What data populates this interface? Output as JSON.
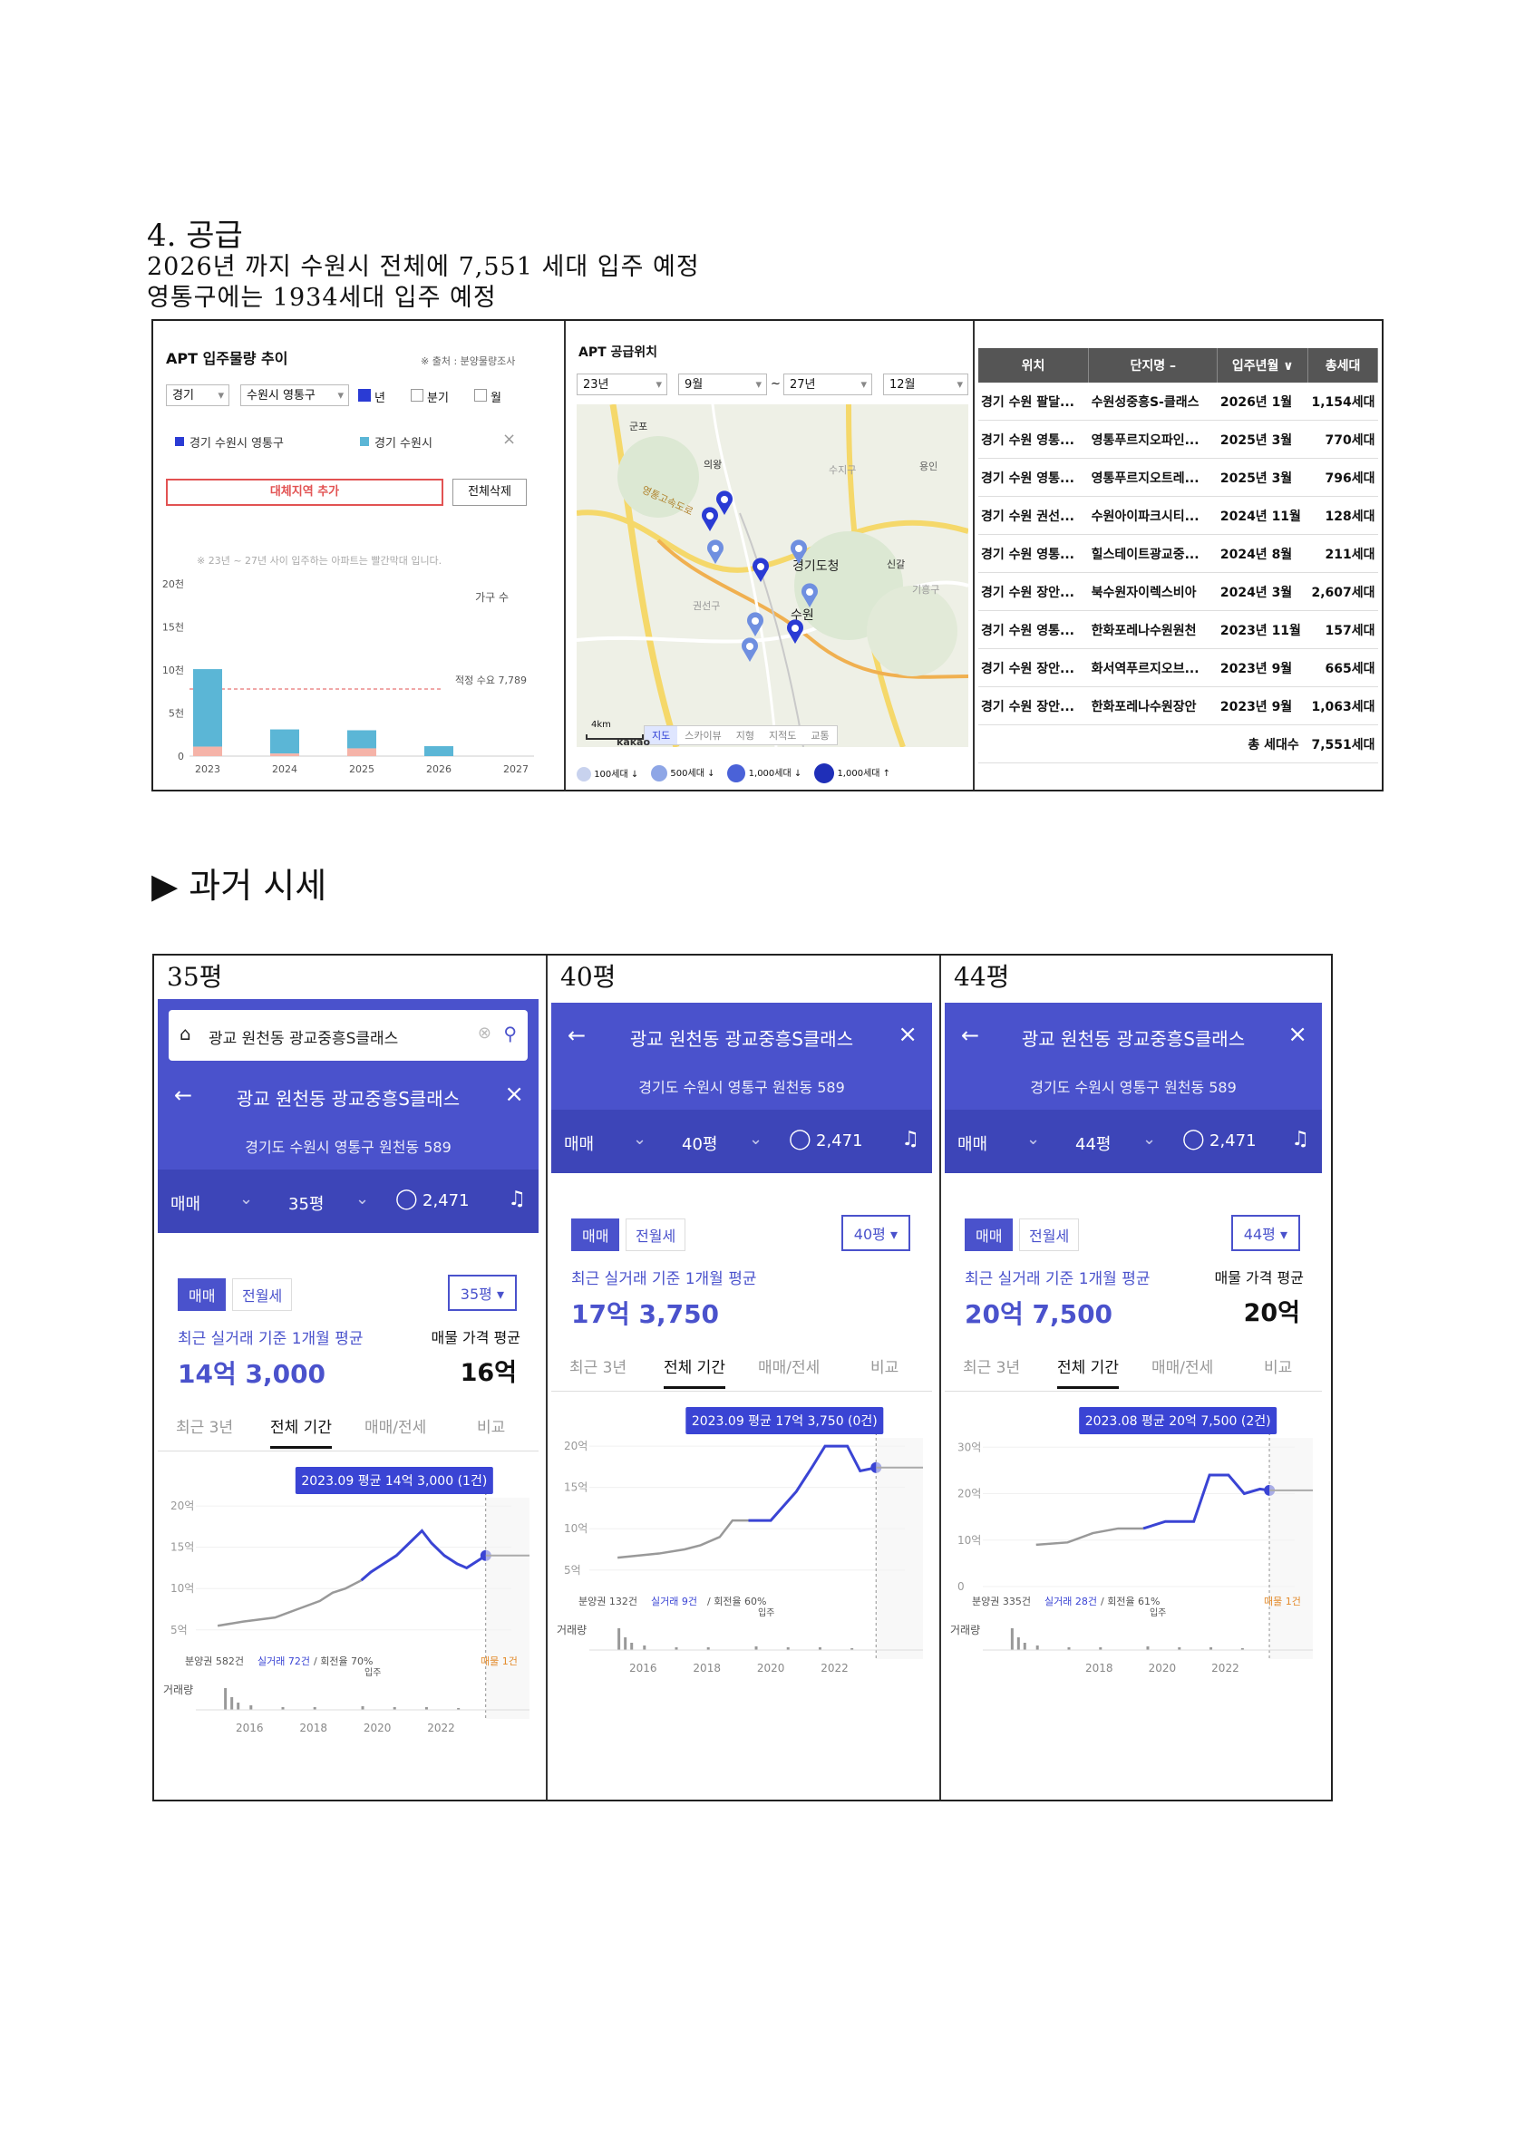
{
  "doc": {
    "heading": "4. 공급",
    "line1": "2026년 까지 수원시 전체에 7,551 세대 입주 예정",
    "line2": "영통구에는 1934세대 입주 예정",
    "past_title": "▶ 과거 시세"
  },
  "supply_panel": {
    "title": "APT 입주물량 추이",
    "source": "※ 출처 : 분양물량조사",
    "region1": "경기",
    "region2": "수원시 영통구",
    "period_options": [
      "년",
      "분기",
      "월"
    ],
    "legend": [
      "경기 수원시 영통구",
      "경기 수원시"
    ],
    "add_button": "대체지역 추가",
    "delete_button": "전체삭제",
    "note": "※ 23년 ~ 27년 사이 입주하는 아파트는 빨간막대 입니다.",
    "unit_label": "가구 수",
    "demand_label": "적정 수요 7,789",
    "chart_data": {
      "type": "bar",
      "categories": [
        "2023",
        "2024",
        "2025",
        "2026",
        "2027"
      ],
      "series": [
        {
          "name": "경기 수원시 영통구",
          "values": [
            1.1,
            0.3,
            0.9,
            0,
            0
          ]
        },
        {
          "name": "경기 수원시",
          "values": [
            10.1,
            3.1,
            3.0,
            1.154,
            0
          ]
        }
      ],
      "yticks": [
        "0",
        "5천",
        "10천",
        "15천",
        "20천"
      ],
      "ylim": [
        0,
        20
      ],
      "demand": 7.789
    }
  },
  "map_panel": {
    "title": "APT 공급위치",
    "from_year": "23년",
    "from_month": "9월",
    "to_year": "27년",
    "to_month": "12월",
    "labels": [
      "군포",
      "의왕",
      "수지구",
      "경기도청",
      "수원",
      "권선구",
      "신갈",
      "기흥구",
      "용인",
      "영통고속도로"
    ],
    "map_tabs": [
      "지도",
      "스카이뷰",
      "지형",
      "지적도",
      "교통"
    ],
    "legend": [
      "100세대 ↓",
      "500세대 ↓",
      "1,000세대 ↓",
      "1,000세대 ↑"
    ],
    "scale": "4km",
    "brand": "kakao",
    "colors": {
      "marker": "#2a3bd4",
      "marker_light": "#6f8fe0"
    }
  },
  "supply_table": {
    "headers": [
      "위치",
      "단지명 –",
      "입주년월 ∨",
      "총세대"
    ],
    "rows": [
      [
        "경기 수원 팔달...",
        "수원성중흥S-클래스",
        "2026년 1월",
        "1,154세대"
      ],
      [
        "경기 수원 영통...",
        "영통푸르지오파인...",
        "2025년 3월",
        "770세대"
      ],
      [
        "경기 수원 영통...",
        "영통푸르지오트레...",
        "2025년 3월",
        "796세대"
      ],
      [
        "경기 수원 권선...",
        "수원아이파크시티...",
        "2024년 11월",
        "128세대"
      ],
      [
        "경기 수원 영통...",
        "힐스테이트광교중...",
        "2024년 8월",
        "211세대"
      ],
      [
        "경기 수원 장안...",
        "북수원자이렉스비아",
        "2024년 3월",
        "2,607세대"
      ],
      [
        "경기 수원 영통...",
        "한화포레나수원원천",
        "2023년 11월",
        "157세대"
      ],
      [
        "경기 수원 장안...",
        "화서역푸르지오브...",
        "2023년 9월",
        "665세대"
      ],
      [
        "경기 수원 장안...",
        "한화포레나수원장안",
        "2023년 9월",
        "1,063세대"
      ]
    ],
    "total_label": "총 세대수",
    "total_value": "7,551세대"
  },
  "phones": [
    {
      "size_label": "35평",
      "search_text": "광교 원천동 광교중흥S클래스",
      "title": "광교 원천동 광교중흥S클래스",
      "address": "경기도 수원시 영통구 원천동 589",
      "trade_type": "매매",
      "size_select": "35평",
      "comments": "2,471",
      "tab_sale": "매매",
      "tab_rent": "전월세",
      "size_pill": "35평",
      "avg_label": "최근 실거래 기준 1개월 평균",
      "avg_price": "14억 3,000",
      "listing_label": "매물 가격 평균",
      "listing_price": "16억",
      "tabs": [
        "최근 3년",
        "전체 기간",
        "매매/전세",
        "비교"
      ],
      "tooltip": "2023.09 평균 14억 3,000 (1건)",
      "yticks": [
        "20억",
        "15억",
        "10억",
        "5억"
      ],
      "footer": "분양권 582건",
      "footer_link": "실거래 72건",
      "footer_rate": "/ 회전율 70%",
      "move_in": "입주",
      "listing_note": "매물 1건",
      "volume_label": "거래량",
      "xticks": [
        "2016",
        "2018",
        "2020",
        "2022"
      ],
      "chart_data": {
        "type": "line",
        "ylim": [
          3,
          21
        ],
        "series": [
          {
            "values": [
              [
                2015.0,
                5.5
              ],
              [
                2015.8,
                6.0
              ],
              [
                2016.8,
                6.5
              ],
              [
                2017.5,
                7.5
              ],
              [
                2018.2,
                8.5
              ],
              [
                2018.6,
                9.5
              ],
              [
                2019.0,
                10.0
              ],
              [
                2019.5,
                11.0
              ],
              [
                2019.8,
                12.0
              ],
              [
                2020.2,
                13.0
              ],
              [
                2020.6,
                14.0
              ],
              [
                2021.0,
                15.5
              ],
              [
                2021.4,
                17.0
              ],
              [
                2021.7,
                15.5
              ],
              [
                2022.1,
                14.0
              ],
              [
                2022.5,
                13.0
              ],
              [
                2022.8,
                12.5
              ],
              [
                2023.2,
                13.5
              ],
              [
                2023.4,
                14.0
              ]
            ]
          }
        ]
      }
    },
    {
      "size_label": "40평",
      "title": "광교 원천동 광교중흥S클래스",
      "address": "경기도 수원시 영통구 원천동 589",
      "trade_type": "매매",
      "size_select": "40평",
      "comments": "2,471",
      "tab_sale": "매매",
      "tab_rent": "전월세",
      "size_pill": "40평",
      "avg_label": "최근 실거래 기준 1개월 평균",
      "avg_price": "17억 3,750",
      "tabs": [
        "최근 3년",
        "전체 기간",
        "매매/전세",
        "비교"
      ],
      "tooltip": "2023.09 평균 17억 3,750 (0건)",
      "yticks": [
        "20억",
        "15억",
        "10억",
        "5억"
      ],
      "footer": "분양권 132건",
      "footer_link": "실거래 9건",
      "footer_rate": "/ 회전율 60%",
      "move_in": "입주",
      "volume_label": "거래량",
      "xticks": [
        "2016",
        "2018",
        "2020",
        "2022"
      ],
      "chart_data": {
        "type": "line",
        "ylim": [
          3,
          21
        ],
        "series": [
          {
            "values": [
              [
                2015.2,
                6.5
              ],
              [
                2016.5,
                7.0
              ],
              [
                2017.3,
                7.5
              ],
              [
                2017.8,
                8.0
              ],
              [
                2018.4,
                9.0
              ],
              [
                2018.8,
                11.0
              ],
              [
                2019.3,
                11.0
              ],
              [
                2020.0,
                11.0
              ],
              [
                2020.8,
                14.5
              ],
              [
                2021.3,
                17.5
              ],
              [
                2021.7,
                20.0
              ],
              [
                2022.4,
                20.0
              ],
              [
                2022.8,
                17.0
              ],
              [
                2023.3,
                17.4
              ]
            ]
          }
        ]
      }
    },
    {
      "size_label": "44평",
      "title": "광교 원천동 광교중흥S클래스",
      "address": "경기도 수원시 영통구 원천동 589",
      "trade_type": "매매",
      "size_select": "44평",
      "comments": "2,471",
      "tab_sale": "매매",
      "tab_rent": "전월세",
      "size_pill": "44평",
      "avg_label": "최근 실거래 기준 1개월 평균",
      "avg_price": "20억 7,500",
      "listing_label": "매물 가격 평균",
      "listing_price": "20억",
      "tabs": [
        "최근 3년",
        "전체 기간",
        "매매/전세",
        "비교"
      ],
      "tooltip": "2023.08 평균 20억 7,500 (2건)",
      "yticks": [
        "30억",
        "20억",
        "10억",
        "0"
      ],
      "footer": "분양권 335건",
      "footer_link": "실거래 28건",
      "footer_rate": "/ 회전율 61%",
      "move_in": "입주",
      "listing_note": "매물 1건",
      "volume_label": "거래량",
      "xticks": [
        "2018",
        "2020",
        "2022"
      ],
      "chart_data": {
        "type": "line",
        "ylim": [
          0,
          32
        ],
        "series": [
          {
            "values": [
              [
                2016.0,
                9.0
              ],
              [
                2017.0,
                9.5
              ],
              [
                2017.8,
                11.5
              ],
              [
                2018.6,
                12.5
              ],
              [
                2019.4,
                12.5
              ],
              [
                2020.1,
                14.0
              ],
              [
                2021.0,
                14.0
              ],
              [
                2021.5,
                24.0
              ],
              [
                2022.1,
                24.0
              ],
              [
                2022.6,
                20.0
              ],
              [
                2023.1,
                21.0
              ],
              [
                2023.4,
                20.7
              ]
            ]
          }
        ]
      }
    }
  ]
}
